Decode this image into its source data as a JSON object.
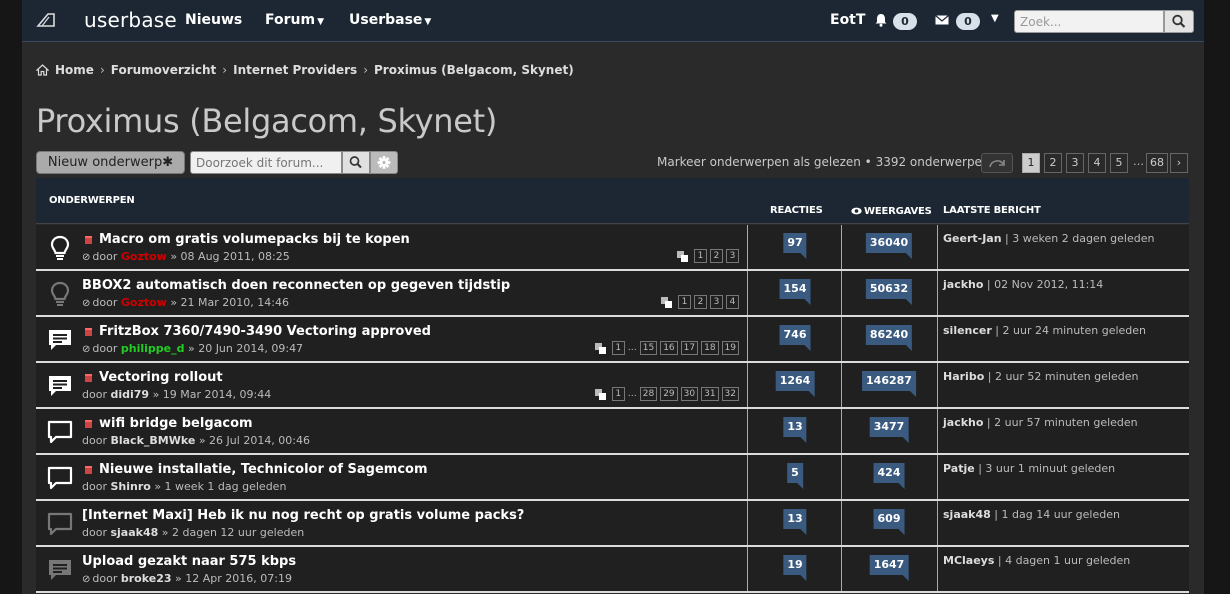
{
  "header": {
    "logo_text": "userbase",
    "nav": [
      "Nieuws",
      "Forum",
      "Userbase"
    ],
    "username": "EotT",
    "notifications_count": "0",
    "messages_count": "0",
    "search_placeholder": "Zoek..."
  },
  "breadcrumb": [
    "Home",
    "Forumoverzicht",
    "Internet Providers",
    "Proximus (Belgacom, Skynet)"
  ],
  "forum_title": "Proximus (Belgacom, Skynet)",
  "actions": {
    "new_topic": "Nieuw onderwerp",
    "forum_search_placeholder": "Doorzoek dit forum...",
    "mark_read": "Markeer onderwerpen als gelezen • 3392 onderwerpen"
  },
  "pagination": [
    "1",
    "2",
    "3",
    "4",
    "5",
    "…",
    "68"
  ],
  "table_headers": {
    "topics": "ONDERWERPEN",
    "replies": "REACTIES",
    "views": "WEERGAVES",
    "last_post": "LAATSTE BERICHT"
  },
  "topics": [
    {
      "icon": "lightbulb-icon",
      "icon_color": "#ffffff",
      "hot": true,
      "title": "Macro om gratis volumepacks bij te kopen",
      "attach": true,
      "by": "door",
      "author": "Goztow",
      "author_class": "red",
      "date": "» 08 Aug 2011, 08:25",
      "pages": [
        "1",
        "2",
        "3"
      ],
      "replies": "97",
      "views": "36040",
      "last_user": "Geert-Jan",
      "last_time": "| 3 weken 2 dagen geleden"
    },
    {
      "icon": "lightbulb-icon",
      "icon_color": "#777777",
      "hot": false,
      "title": "BBOX2 automatisch doen reconnecten op gegeven tijdstip",
      "attach": true,
      "by": "door",
      "author": "Goztow",
      "author_class": "red",
      "date": "» 21 Mar 2010, 14:46",
      "pages": [
        "1",
        "2",
        "3",
        "4"
      ],
      "replies": "154",
      "views": "50632",
      "last_user": "jackho",
      "last_time": "| 02 Nov 2012, 11:14"
    },
    {
      "icon": "chat-filled-icon",
      "icon_color": "#ffffff",
      "hot": true,
      "title": "FritzBox 7360/7490-3490 Vectoring approved",
      "attach": true,
      "by": "door",
      "author": "philippe_d",
      "author_class": "green",
      "date": "» 20 Jun 2014, 09:47",
      "pages": [
        "1",
        "…",
        "15",
        "16",
        "17",
        "18",
        "19"
      ],
      "replies": "746",
      "views": "86240",
      "last_user": "silencer",
      "last_time": "| 2 uur 24 minuten geleden"
    },
    {
      "icon": "chat-filled-icon",
      "icon_color": "#ffffff",
      "hot": true,
      "title": "Vectoring rollout",
      "attach": false,
      "by": "door",
      "author": "didi79",
      "author_class": "",
      "date": "» 19 Mar 2014, 09:44",
      "pages": [
        "1",
        "…",
        "28",
        "29",
        "30",
        "31",
        "32"
      ],
      "replies": "1264",
      "views": "146287",
      "last_user": "Haribo",
      "last_time": "| 2 uur 52 minuten geleden"
    },
    {
      "icon": "chat-outline-icon",
      "icon_color": "#ffffff",
      "hot": true,
      "title": "wifi bridge belgacom",
      "attach": false,
      "by": "door",
      "author": "Black_BMWke",
      "author_class": "",
      "date": "» 26 Jul 2014, 00:46",
      "pages": [],
      "replies": "13",
      "views": "3477",
      "last_user": "jackho",
      "last_time": "| 2 uur 57 minuten geleden"
    },
    {
      "icon": "chat-outline-icon",
      "icon_color": "#ffffff",
      "hot": true,
      "title": "Nieuwe installatie, Technicolor of Sagemcom",
      "attach": false,
      "by": "door",
      "author": "Shinro",
      "author_class": "",
      "date": "» 1 week 1 dag geleden",
      "pages": [],
      "replies": "5",
      "views": "424",
      "last_user": "Patje",
      "last_time": "| 3 uur 1 minuut geleden"
    },
    {
      "icon": "chat-outline-icon",
      "icon_color": "#777777",
      "hot": false,
      "title": "[Internet Maxi] Heb ik nu nog recht op gratis volume packs?",
      "attach": false,
      "by": "door",
      "author": "sjaak48",
      "author_class": "",
      "date": "» 2 dagen 12 uur geleden",
      "pages": [],
      "replies": "13",
      "views": "609",
      "last_user": "sjaak48",
      "last_time": "| 1 dag 14 uur geleden"
    },
    {
      "icon": "chat-filled-icon",
      "icon_color": "#777777",
      "hot": false,
      "title": "Upload gezakt naar 575 kbps",
      "attach": true,
      "by": "door",
      "author": "broke23",
      "author_class": "",
      "date": "» 12 Apr 2016, 07:19",
      "pages": [],
      "replies": "19",
      "views": "1647",
      "last_user": "MClaeys",
      "last_time": "| 4 dagen 1 uur geleden"
    }
  ]
}
